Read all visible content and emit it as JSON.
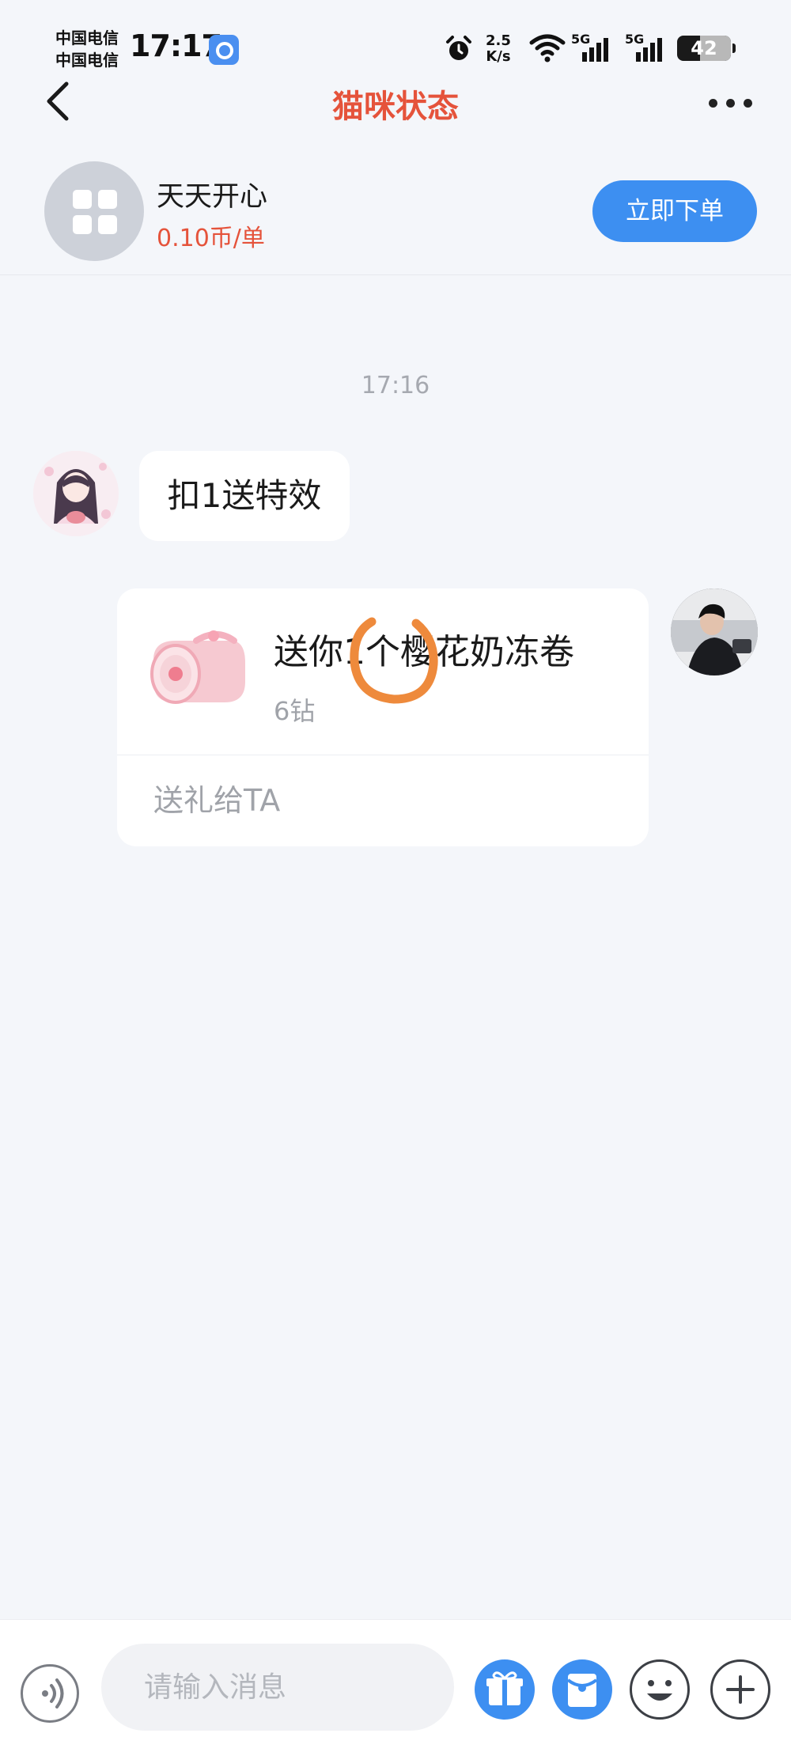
{
  "status_bar": {
    "carrier_1": "中国电信",
    "carrier_2": "中国电信",
    "time": "17:17",
    "net_speed_value": "2.5",
    "net_speed_unit": "K/s",
    "signal_1_label": "5G",
    "signal_2_label": "5G",
    "battery": "42",
    "battery_level": 0.42,
    "icons": [
      "app-badge-icon",
      "alarm-icon",
      "wifi-icon",
      "signal-icon",
      "battery-icon"
    ]
  },
  "nav": {
    "title": "猫咪状态",
    "title_color": "#e5533b"
  },
  "shop": {
    "name": "天天开心",
    "price": "0.10币/单",
    "order_button": "立即下单",
    "accent_color": "#3d8ff1"
  },
  "chat": {
    "timestamp": "17:16",
    "messages": [
      {
        "side": "left",
        "text": "扣1送特效"
      },
      {
        "side": "right",
        "type": "gift",
        "title": "送你1个樱花奶冻卷",
        "price": "6钻",
        "action": "送礼给TA"
      }
    ]
  },
  "input_bar": {
    "placeholder": "请输入消息",
    "buttons": [
      "voice-icon",
      "gift-icon",
      "red-packet-icon",
      "emoji-icon",
      "plus-icon"
    ]
  }
}
